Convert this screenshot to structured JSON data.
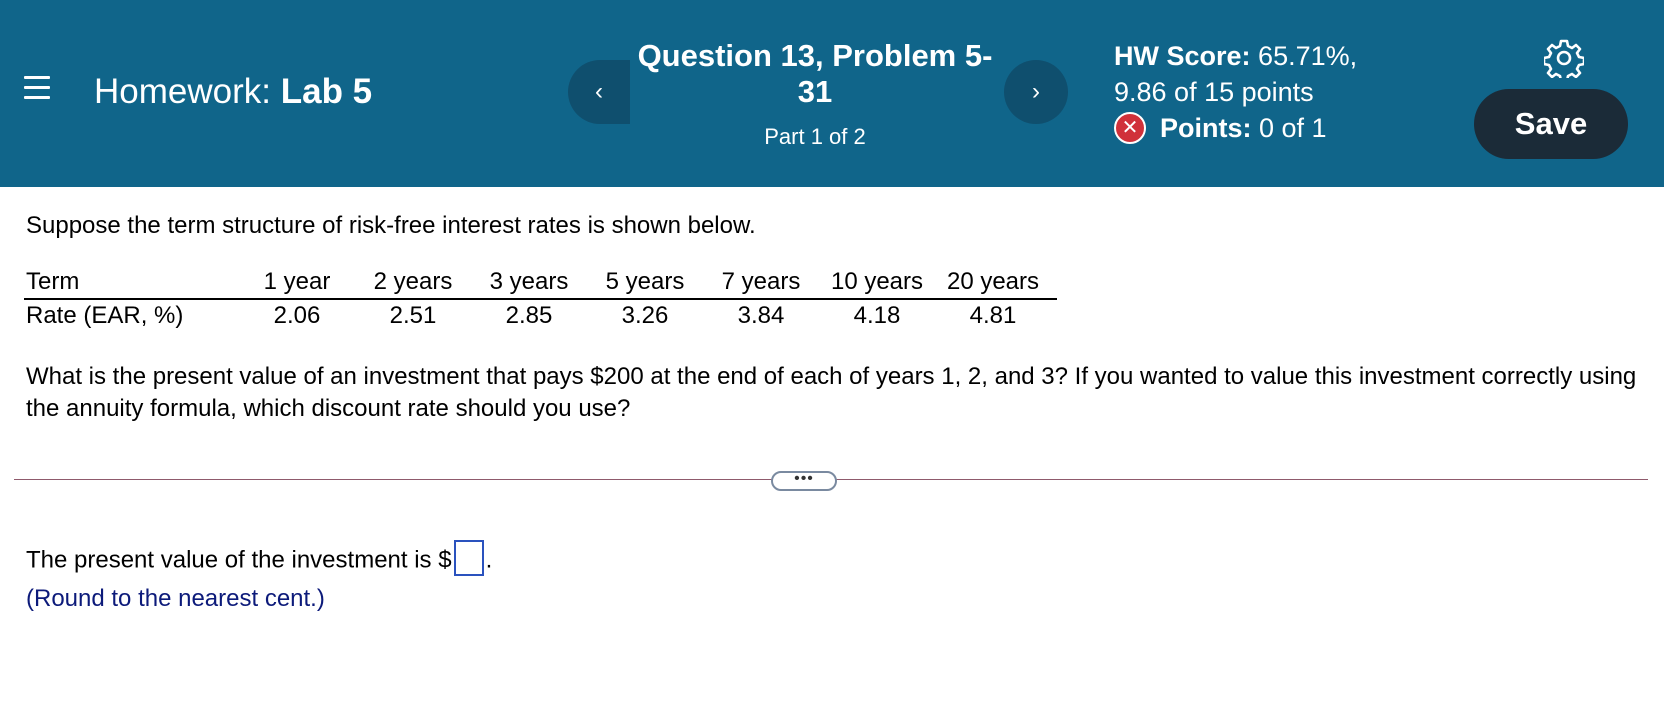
{
  "header": {
    "menu_icon": "hamburger-menu-icon",
    "homework_prefix": "Homework:",
    "homework_name": "Lab 5",
    "prev_label": "‹",
    "next_label": "›",
    "question_title": "Question 13, Problem 5-31",
    "question_part": "Part 1 of 2",
    "hw_score_label": "HW Score:",
    "hw_score_value": "65.71%,",
    "points_total": "9.86 of 15 points",
    "points_label": "Points:",
    "points_value": "0 of 1",
    "status_icon": "incorrect-x-icon",
    "settings_icon": "gear-icon",
    "save_label": "Save",
    "colors": {
      "header_bg": "#10658a",
      "save_bg": "#1b2b38",
      "incorrect": "#d0313a"
    }
  },
  "problem": {
    "intro": "Suppose the term structure of risk-free interest rates is shown below.",
    "table": {
      "row_labels": [
        "Term",
        "Rate (EAR, %)"
      ],
      "terms": [
        "1 year",
        "2 years",
        "3 years",
        "5 years",
        "7 years",
        "10 years",
        "20 years"
      ],
      "rates": [
        "2.06",
        "2.51",
        "2.85",
        "3.26",
        "3.84",
        "4.18",
        "4.81"
      ]
    },
    "question": "What is the present value of an investment that pays $200 at the end of each of years 1, 2, and 3? If you wanted to value this investment correctly using the annuity formula, which discount rate should you use?",
    "more_label": "•••"
  },
  "answer": {
    "prompt": "The present value of the investment is $",
    "suffix": ".",
    "value": "",
    "hint": "(Round to the nearest cent.)"
  }
}
